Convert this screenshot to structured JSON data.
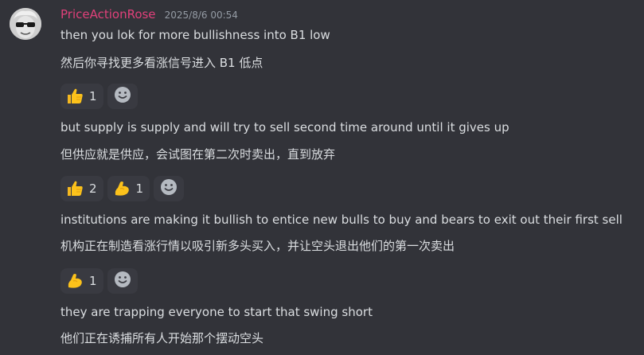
{
  "message": {
    "author": "PriceActionRose",
    "timestamp": "2025/8/6 00:54",
    "lines": [
      "then you lok for more bullishness into B1 low",
      "然后你寻找更多看涨信号进入 B1 低点",
      "but supply is supply and will try to sell second time around until it gives up",
      "但供应就是供应，会试图在第二次时卖出，直到放弃",
      "institutions are making it bullish to entice new bulls to buy and bears to exit out their first sell",
      "机构正在制造看涨行情以吸引新多头买入，并让空头退出他们的第一次卖出",
      "they are trapping everyone to start that swing short",
      "他们正在诱捕所有人开始那个摆动空头"
    ]
  },
  "reactions": {
    "group1": [
      {
        "emoji": "thumbs-up-icon",
        "count": "1"
      }
    ],
    "group2": [
      {
        "emoji": "thumbs-up-icon",
        "count": "2"
      },
      {
        "emoji": "flexed-biceps-icon",
        "count": "1"
      }
    ],
    "group3": [
      {
        "emoji": "flexed-biceps-icon",
        "count": "1"
      }
    ]
  },
  "colors": {
    "background": "#323339",
    "username": "#e0407a",
    "text": "#dbdee1",
    "timestamp": "#949ba4",
    "reaction_bg": "#393a41"
  }
}
